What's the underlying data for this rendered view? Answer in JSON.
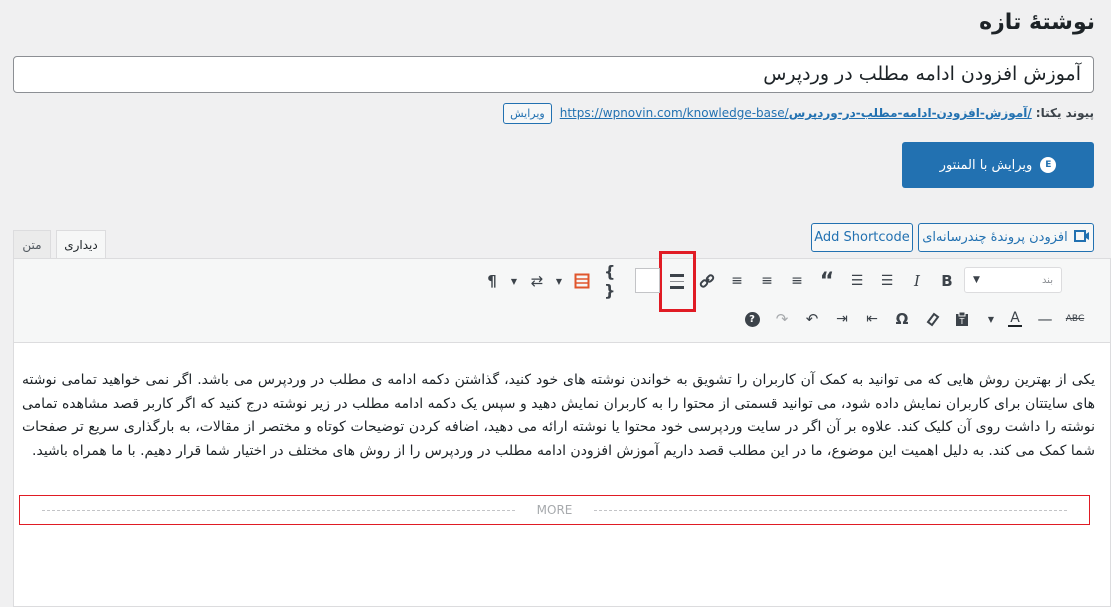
{
  "page": {
    "title": "نوشتهٔ تازه"
  },
  "post": {
    "title_value": "آموزش افزودن ادامه مطلب در وردپرس"
  },
  "permalink": {
    "label": "پیوند یکتا:",
    "base": "https://wpnovin.com/knowledge-base/",
    "slug": "آموزش-افزودن-ادامه-مطلب-در-وردپرس/",
    "edit_label": "ویرایش"
  },
  "elementor": {
    "label": "ویرایش با المنتور",
    "icon": "elementor-icon"
  },
  "media": {
    "add_media_label": "افزودن پروندهٔ چندرسانه‌ای",
    "add_shortcode_label": "Add Shortcode"
  },
  "editor_tabs": {
    "visual": "دیداری",
    "text": "متن"
  },
  "toolbar": {
    "format_select_value": "بند",
    "row1_icons": [
      "bold",
      "italic",
      "bullet-list",
      "numbered-list",
      "blockquote",
      "align-left",
      "align-center",
      "align-right",
      "link",
      "read-more",
      "code-braces",
      "table",
      "shortcode-loop",
      "rtl-paragraph"
    ],
    "row2_icons": [
      "strikethrough",
      "horizontal-line",
      "text-color",
      "paste-as-text",
      "clear-formatting",
      "special-character",
      "outdent",
      "indent",
      "undo",
      "redo",
      "help"
    ],
    "highlight_color": "#e01b24"
  },
  "content": {
    "paragraph": "یکی از بهترین روش هایی که می توانید به کمک آن کاربران را تشویق به خواندن نوشته های خود کنید، گذاشتن دکمه ادامه ی مطلب در وردپرس می باشد. اگر نمی خواهید تمامی نوشته های سایتتان برای کاربران نمایش داده شود، می توانید قسمتی از محتوا را به کاربران نمایش دهید و سپس یک دکمه ادامه مطلب در زیر نوشته درج کنید که اگر کاربر قصد مشاهده تمامی نوشته را داشت روی آن کلیک کند. علاوه بر آن اگر در سایت وردپرسی خود محتوا یا نوشته ارائه می دهید، اضافه کردن توضیحات کوتاه و مختصر از مقالات، به بارگذاری سریع تر صفحات شما کمک می کند.  به دلیل اهمیت این موضوع، ما در این مطلب قصد داریم آموزش افزودن ادامه مطلب در وردپرس را از روش های مختلف در اختیار شما قرار دهیم. با ما همراه باشید.",
    "more_label": "MORE"
  }
}
